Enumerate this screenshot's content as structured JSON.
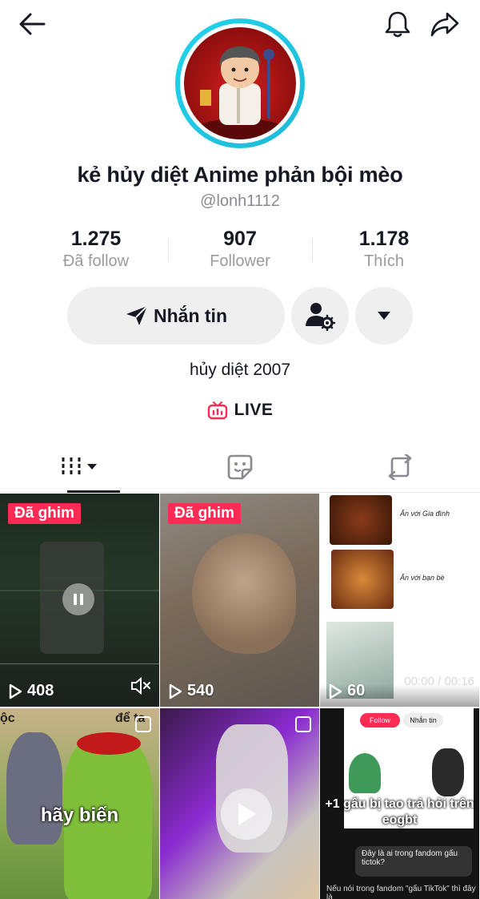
{
  "profile": {
    "display_name": "kẻ hủy diệt Anime phản bội mèo",
    "username": "@lonh1112",
    "bio": "hủy diệt 2007",
    "live_label": "LIVE"
  },
  "stats": [
    {
      "value": "1.275",
      "label": "Đã follow"
    },
    {
      "value": "907",
      "label": "Follower"
    },
    {
      "value": "1.178",
      "label": "Thích"
    }
  ],
  "actions": {
    "message_label": "Nhắn tin"
  },
  "colors": {
    "accent": "#fe2c55",
    "ring": "#20d5ec",
    "text": "#161823",
    "muted": "#8a8b91"
  },
  "icons": {
    "back": "arrow-left-icon",
    "bell": "bell-icon",
    "share": "share-icon",
    "message": "paper-plane-icon",
    "friend_settings": "user-gear-icon",
    "more": "caret-down-icon",
    "live": "tv-icon",
    "tab_videos": "grid-icon",
    "tab_favorites": "sticker-icon",
    "tab_reposts": "repost-icon"
  },
  "videos": [
    {
      "pinned_label": "Đã ghim",
      "views": "408",
      "muted": true
    },
    {
      "pinned_label": "Đã ghim",
      "views": "540"
    },
    {
      "views": "60",
      "timestamp": "00:00 / 00:16",
      "side_text_1": "Ăn với Gia đình",
      "side_text_2": "Ăn với bạn bè"
    },
    {
      "caption": "hãy biến",
      "corner_text_1": "ộc",
      "corner_text_2": "để ta"
    },
    {},
    {
      "caption": "+1 gấu bị tao trả hỏi trên eogbt",
      "chat_text": "Đây là ai trong fandom gấu tictok?",
      "follow_label": "Follow",
      "msg_label": "Nhắn tin",
      "bottom_text": "Nếu nói trong fandom \"gấu TikTok\" thì đây là"
    }
  ]
}
